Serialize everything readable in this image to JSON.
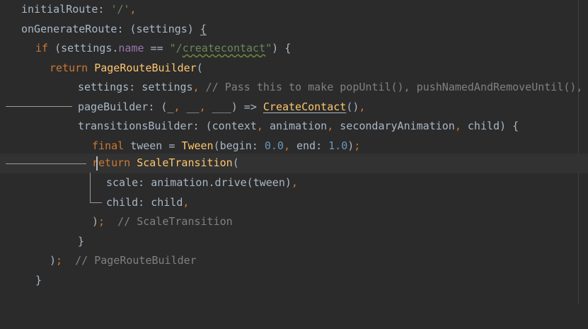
{
  "editor": {
    "language": "dart",
    "theme_background": "#2b2b2b",
    "lines": [
      {
        "segments": [
          {
            "t": "initialRoute: ",
            "c": "tok-punc"
          },
          {
            "t": "'/'",
            "c": "tok-str"
          },
          {
            "t": ",",
            "c": "tok-kw"
          }
        ]
      },
      {
        "segments": [
          {
            "t": "onGenerateRoute: (settings) ",
            "c": "tok-punc"
          },
          {
            "t": "{",
            "c": "tok-punc tok-ul-plain"
          }
        ]
      },
      {
        "segments": [
          {
            "t": "if ",
            "c": "tok-kw"
          },
          {
            "t": "(settings.",
            "c": "tok-punc"
          },
          {
            "t": "name",
            "c": "tok-prop"
          },
          {
            "t": " == ",
            "c": "tok-punc"
          },
          {
            "t": "\"/",
            "c": "tok-str"
          },
          {
            "t": "createcontact",
            "c": "tok-str tok-ul"
          },
          {
            "t": "\"",
            "c": "tok-str"
          },
          {
            "t": ") {",
            "c": "tok-punc"
          }
        ]
      },
      {
        "segments": [
          {
            "t": "return ",
            "c": "tok-kw"
          },
          {
            "t": "PageRouteBuilder",
            "c": "tok-cls"
          },
          {
            "t": "(",
            "c": "tok-punc"
          }
        ]
      },
      {
        "segments": [
          {
            "t": "settings: settings",
            "c": "tok-punc"
          },
          {
            "t": ", ",
            "c": "tok-kw"
          },
          {
            "t": "// Pass this to make popUntil(), pushNamedAndRemoveUntil(), work",
            "c": "tok-cmt"
          }
        ]
      },
      {
        "segments": [
          {
            "t": "pageBuilder: (_",
            "c": "tok-punc"
          },
          {
            "t": ", ",
            "c": "tok-kw"
          },
          {
            "t": "__",
            "c": "tok-punc"
          },
          {
            "t": ", ",
            "c": "tok-kw"
          },
          {
            "t": "___) => ",
            "c": "tok-punc"
          },
          {
            "t": "CreateContact",
            "c": "tok-cls tok-ul-plain"
          },
          {
            "t": "()",
            "c": "tok-punc"
          },
          {
            "t": ",",
            "c": "tok-kw"
          }
        ]
      },
      {
        "segments": [
          {
            "t": "transitionsBuilder: (context",
            "c": "tok-punc"
          },
          {
            "t": ", ",
            "c": "tok-kw"
          },
          {
            "t": "animation",
            "c": "tok-punc"
          },
          {
            "t": ", ",
            "c": "tok-kw"
          },
          {
            "t": "secondaryAnimation",
            "c": "tok-punc"
          },
          {
            "t": ", ",
            "c": "tok-kw"
          },
          {
            "t": "child) {",
            "c": "tok-punc"
          }
        ]
      },
      {
        "segments": [
          {
            "t": "final ",
            "c": "tok-kw"
          },
          {
            "t": "tween = ",
            "c": "tok-punc"
          },
          {
            "t": "Tween",
            "c": "tok-cls"
          },
          {
            "t": "(begin: ",
            "c": "tok-punc"
          },
          {
            "t": "0.0",
            "c": "tok-num"
          },
          {
            "t": ", ",
            "c": "tok-kw"
          },
          {
            "t": "end: ",
            "c": "tok-punc"
          },
          {
            "t": "1.0",
            "c": "tok-num"
          },
          {
            "t": ")",
            "c": "tok-punc"
          },
          {
            "t": ";",
            "c": "tok-kw"
          }
        ]
      },
      {
        "segments": [
          {
            "t": "return ",
            "c": "tok-kw"
          },
          {
            "t": "ScaleTransition",
            "c": "tok-cls"
          },
          {
            "t": "(",
            "c": "tok-punc"
          }
        ]
      },
      {
        "segments": [
          {
            "t": "scale: animation.drive(tween)",
            "c": "tok-punc"
          },
          {
            "t": ",",
            "c": "tok-kw"
          }
        ]
      },
      {
        "segments": [
          {
            "t": "child: child",
            "c": "tok-punc"
          },
          {
            "t": ",",
            "c": "tok-kw"
          }
        ]
      },
      {
        "segments": [
          {
            "t": ")",
            "c": "tok-punc"
          },
          {
            "t": ";",
            "c": "tok-kw"
          },
          {
            "t": "  // ScaleTransition",
            "c": "tok-cmt"
          }
        ]
      },
      {
        "segments": [
          {
            "t": "}",
            "c": "tok-punc"
          }
        ]
      },
      {
        "segments": [
          {
            "t": ")",
            "c": "tok-punc"
          },
          {
            "t": ";",
            "c": "tok-kw"
          },
          {
            "t": "  // PageRouteBuilder",
            "c": "tok-cmt"
          }
        ]
      },
      {
        "segments": [
          {
            "t": "}",
            "c": "tok-punc"
          }
        ]
      }
    ]
  }
}
